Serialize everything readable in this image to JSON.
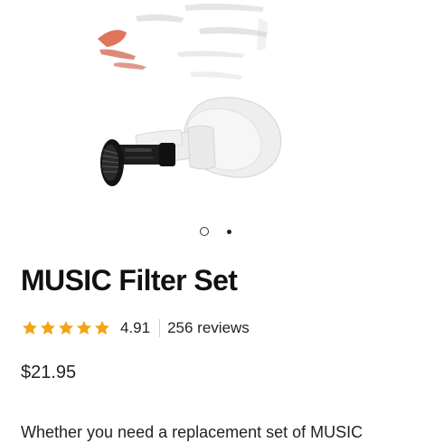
{
  "product": {
    "title": "MUSIC Filter Set",
    "rating_value": "4.91",
    "rating_stars": 5,
    "review_count": "256 reviews",
    "price": "$21.95",
    "description_preview": "Whether you need a replacement set of MUSIC"
  },
  "gallery": {
    "image_count": 2,
    "active_index": 0
  },
  "colors": {
    "star": "#F2A413",
    "text": "#111111",
    "filter_body": "#1A1A1A",
    "eartip": "#EFEFEF"
  },
  "icons": {
    "star": "star-icon",
    "active_dot": "carousel-dot-active",
    "inactive_dot": "carousel-dot"
  }
}
